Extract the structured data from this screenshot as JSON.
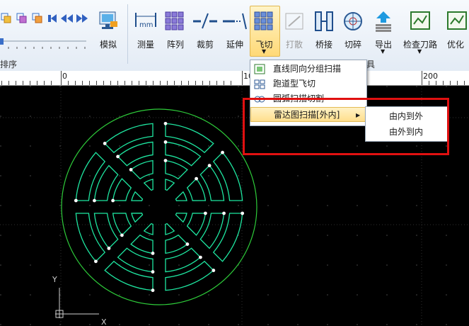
{
  "ribbon": {
    "tools": [
      {
        "label": "模拟",
        "icon": "simulate-icon"
      },
      {
        "label": "测量",
        "icon": "measure-icon"
      },
      {
        "label": "阵列",
        "icon": "array-icon"
      },
      {
        "label": "裁剪",
        "icon": "trim-icon"
      },
      {
        "label": "延伸",
        "icon": "extend-icon"
      },
      {
        "label": "飞切",
        "icon": "fly-cut-icon"
      },
      {
        "label": "打散",
        "icon": "explode-icon"
      },
      {
        "label": "桥接",
        "icon": "bridge-icon"
      },
      {
        "label": "切碎",
        "icon": "shred-icon"
      },
      {
        "label": "导出",
        "icon": "export-icon"
      },
      {
        "label": "检查刀路",
        "icon": "check-path-icon"
      },
      {
        "label": "优化",
        "icon": "optimize-icon"
      }
    ],
    "group_left": "排序",
    "group_mid": "具"
  },
  "ruler": {
    "labels": [
      "0",
      "10",
      "200"
    ]
  },
  "menu": {
    "items": [
      {
        "label": "直线同向分组扫描",
        "icon": "line-scan-icon"
      },
      {
        "label": "跑道型飞切",
        "icon": "racetrack-icon"
      },
      {
        "label": "圆弧扫描切割",
        "icon": "arc-scan-icon"
      },
      {
        "label": "雷达图扫描[外内]",
        "icon": "radar-scan-icon"
      }
    ],
    "submenu": [
      "由内到外",
      "由外到内"
    ]
  },
  "canvas": {
    "y_axis": "Y",
    "x_axis": "X"
  },
  "colors": {
    "part": "#1ee6a0",
    "circle": "#2ecc3a",
    "highlight": "#e01010"
  }
}
